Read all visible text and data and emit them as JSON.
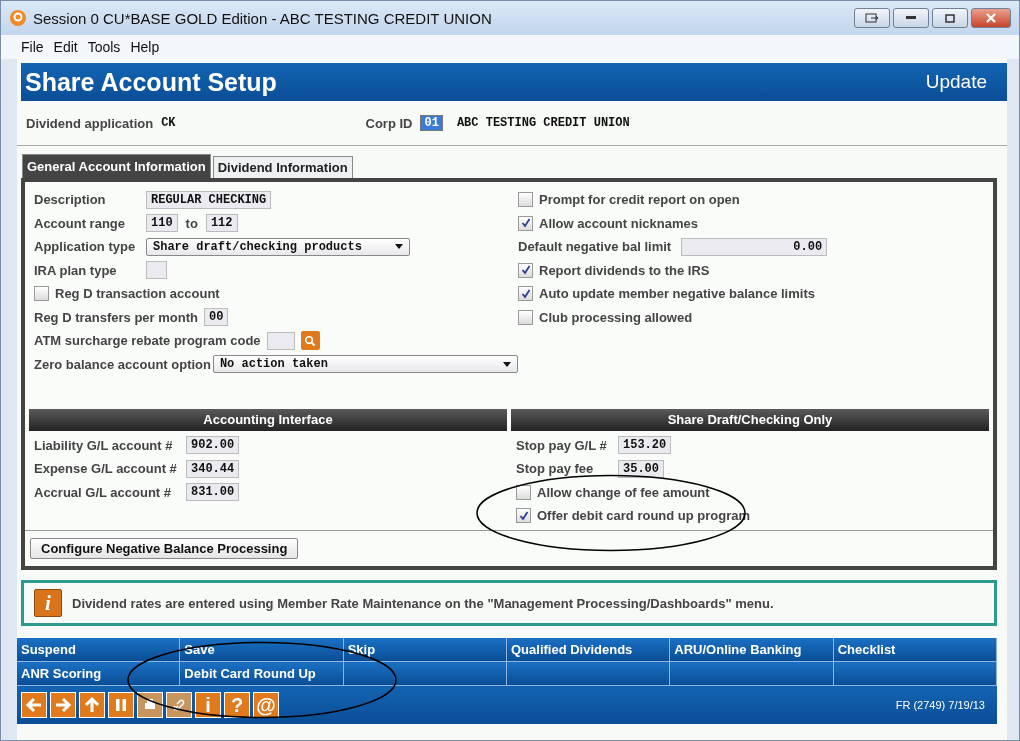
{
  "window": {
    "title": "Session 0 CU*BASE GOLD Edition - ABC TESTING CREDIT UNION"
  },
  "menu": [
    "File",
    "Edit",
    "Tools",
    "Help"
  ],
  "header": {
    "title": "Share Account Setup",
    "mode": "Update"
  },
  "info": {
    "app_label": "Dividend application",
    "app_value": "CK",
    "corp_label": "Corp ID",
    "corp_value": "01",
    "corp_name": "ABC TESTING CREDIT UNION"
  },
  "tabs": [
    {
      "label": "General Account Information",
      "selected": true
    },
    {
      "label": "Dividend Information",
      "selected": false
    }
  ],
  "left_rows": [
    {
      "kind": "field",
      "label": "Description",
      "value": "REGULAR CHECKING"
    },
    {
      "kind": "range",
      "label": "Account range",
      "value": "110",
      "joiner": "to",
      "value2": "112"
    },
    {
      "kind": "select",
      "label": "Application type",
      "value": "Share draft/checking products"
    },
    {
      "kind": "empty",
      "label": "IRA plan type"
    },
    {
      "kind": "checkbox",
      "label": "Reg D transaction account",
      "checked": false
    },
    {
      "kind": "field",
      "label": "Reg D transfers per month",
      "value": "00"
    },
    {
      "kind": "lookup",
      "label": "ATM surcharge rebate program code"
    },
    {
      "kind": "wideselect",
      "label": "Zero balance account option",
      "value": "No action taken"
    }
  ],
  "right_rows": [
    {
      "kind": "checkbox",
      "label": "Prompt for credit report on open",
      "checked": false
    },
    {
      "kind": "checkbox",
      "label": "Allow account nicknames",
      "checked": true
    },
    {
      "kind": "field",
      "label": "Default negative bal limit",
      "value": "0.00"
    },
    {
      "kind": "checkbox",
      "label": "Report dividends to the IRS",
      "checked": true
    },
    {
      "kind": "checkbox",
      "label": "Auto update member negative balance limits",
      "checked": true
    },
    {
      "kind": "checkbox",
      "label": "Club processing allowed",
      "checked": false
    }
  ],
  "sections": [
    {
      "title": "Accounting Interface",
      "rows": [
        {
          "kind": "field",
          "label": "Liability G/L account #",
          "value": "902.00"
        },
        {
          "kind": "field",
          "label": "Expense G/L account #",
          "value": "340.44"
        },
        {
          "kind": "field",
          "label": "Accrual G/L account #",
          "value": "831.00"
        }
      ]
    },
    {
      "title": "Share Draft/Checking Only",
      "rows": [
        {
          "kind": "field",
          "label": "Stop pay G/L #",
          "value": "153.20"
        },
        {
          "kind": "field",
          "label": "Stop pay fee",
          "value": "35.00"
        },
        {
          "kind": "checkbox",
          "label": "Allow change of fee amount",
          "checked": false
        },
        {
          "kind": "checkbox",
          "label": "Offer debit card round up program",
          "checked": true
        }
      ]
    }
  ],
  "configure_button": "Configure Negative Balance Processing",
  "message": {
    "icon": "i",
    "text": "Dividend rates are entered using Member Rate Maintenance on the \"Management Processing/Dashboards\" menu."
  },
  "function_keys": [
    [
      "Suspend",
      "Save",
      "Skip",
      "Qualified Dividends",
      "ARU/Online Banking",
      "Checklist"
    ],
    [
      "ANR Scoring",
      "Debit Card Round Up"
    ]
  ],
  "toolbar": [
    {
      "kind": "back",
      "disabled": false
    },
    {
      "kind": "forward",
      "disabled": false
    },
    {
      "kind": "up",
      "disabled": false
    },
    {
      "kind": "pause",
      "disabled": false
    },
    {
      "kind": "print",
      "disabled": true
    },
    {
      "kind": "link",
      "disabled": true
    },
    {
      "kind": "text",
      "label": "i",
      "disabled": false
    },
    {
      "kind": "text",
      "label": "?",
      "disabled": false
    },
    {
      "kind": "text",
      "label": "@",
      "disabled": false
    }
  ],
  "status": "FR (2749) 7/19/13"
}
